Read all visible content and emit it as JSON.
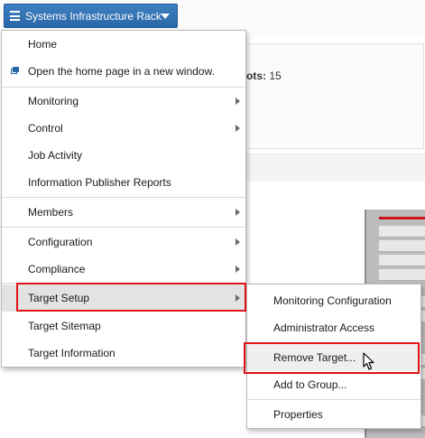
{
  "header": {
    "target_button_label": "Systems Infrastructure Rack"
  },
  "background": {
    "slots_label": "ots:",
    "slots_value": "15"
  },
  "menu": {
    "items": [
      {
        "label": "Home"
      },
      {
        "label": "Open the home page in a new window."
      },
      {
        "label": "Monitoring"
      },
      {
        "label": "Control"
      },
      {
        "label": "Job Activity"
      },
      {
        "label": "Information Publisher Reports"
      },
      {
        "label": "Members"
      },
      {
        "label": "Configuration"
      },
      {
        "label": "Compliance"
      },
      {
        "label": "Target Setup"
      },
      {
        "label": "Target Sitemap"
      },
      {
        "label": "Target Information"
      }
    ]
  },
  "submenu": {
    "items": [
      {
        "label": "Monitoring Configuration"
      },
      {
        "label": "Administrator Access"
      },
      {
        "label": "Remove Target..."
      },
      {
        "label": "Add to Group..."
      },
      {
        "label": "Properties"
      }
    ]
  },
  "colors": {
    "button_blue": "#2a67a8",
    "highlight_red": "#e1141b"
  }
}
